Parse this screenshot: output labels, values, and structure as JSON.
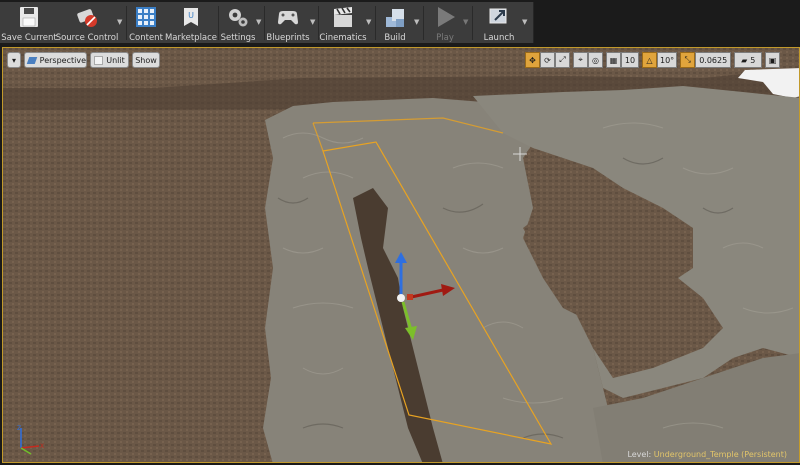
{
  "toolbar": {
    "save_current": "Save Current",
    "source_control": "Source Control",
    "content": "Content",
    "marketplace": "Marketplace",
    "settings": "Settings",
    "blueprints": "Blueprints",
    "cinematics": "Cinematics",
    "build": "Build",
    "play": "Play",
    "launch": "Launch"
  },
  "viewport": {
    "perspective": "Perspective",
    "view_mode": "Unlit",
    "show": "Show",
    "grid_snap_value": "10",
    "rotation_snap_value": "10°",
    "scale_snap_value": "0.0625",
    "camera_speed_value": "5",
    "level_label": "Level:",
    "level_name": "Underground_Temple (Persistent)"
  },
  "colors": {
    "toolbar_bg": "#3c3c3c",
    "ground": "#6d5a48",
    "rock": "#8c8a80",
    "selection_accent": "#e8a322",
    "snap_active": "#e0a43c"
  },
  "icons": {
    "save": "floppy-disk-icon",
    "source_control": "source-control-icon",
    "content": "content-browser-icon",
    "marketplace": "marketplace-icon",
    "settings": "gears-icon",
    "blueprints": "gamepad-icon",
    "cinematics": "clapper-icon",
    "build": "build-blocks-icon",
    "play": "play-icon",
    "launch": "launch-icon"
  }
}
